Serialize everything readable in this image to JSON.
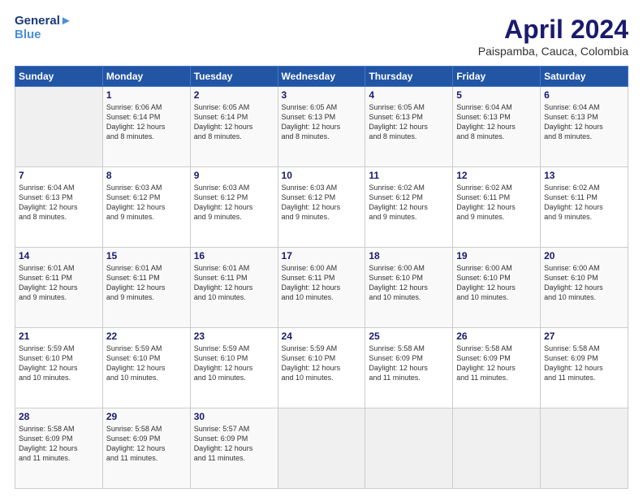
{
  "header": {
    "logo_line1": "General",
    "logo_line2": "Blue",
    "month": "April 2024",
    "location": "Paispamba, Cauca, Colombia"
  },
  "weekdays": [
    "Sunday",
    "Monday",
    "Tuesday",
    "Wednesday",
    "Thursday",
    "Friday",
    "Saturday"
  ],
  "weeks": [
    [
      {
        "day": "",
        "info": ""
      },
      {
        "day": "1",
        "info": "Sunrise: 6:06 AM\nSunset: 6:14 PM\nDaylight: 12 hours\nand 8 minutes."
      },
      {
        "day": "2",
        "info": "Sunrise: 6:05 AM\nSunset: 6:14 PM\nDaylight: 12 hours\nand 8 minutes."
      },
      {
        "day": "3",
        "info": "Sunrise: 6:05 AM\nSunset: 6:13 PM\nDaylight: 12 hours\nand 8 minutes."
      },
      {
        "day": "4",
        "info": "Sunrise: 6:05 AM\nSunset: 6:13 PM\nDaylight: 12 hours\nand 8 minutes."
      },
      {
        "day": "5",
        "info": "Sunrise: 6:04 AM\nSunset: 6:13 PM\nDaylight: 12 hours\nand 8 minutes."
      },
      {
        "day": "6",
        "info": "Sunrise: 6:04 AM\nSunset: 6:13 PM\nDaylight: 12 hours\nand 8 minutes."
      }
    ],
    [
      {
        "day": "7",
        "info": "Sunrise: 6:04 AM\nSunset: 6:13 PM\nDaylight: 12 hours\nand 8 minutes."
      },
      {
        "day": "8",
        "info": "Sunrise: 6:03 AM\nSunset: 6:12 PM\nDaylight: 12 hours\nand 9 minutes."
      },
      {
        "day": "9",
        "info": "Sunrise: 6:03 AM\nSunset: 6:12 PM\nDaylight: 12 hours\nand 9 minutes."
      },
      {
        "day": "10",
        "info": "Sunrise: 6:03 AM\nSunset: 6:12 PM\nDaylight: 12 hours\nand 9 minutes."
      },
      {
        "day": "11",
        "info": "Sunrise: 6:02 AM\nSunset: 6:12 PM\nDaylight: 12 hours\nand 9 minutes."
      },
      {
        "day": "12",
        "info": "Sunrise: 6:02 AM\nSunset: 6:11 PM\nDaylight: 12 hours\nand 9 minutes."
      },
      {
        "day": "13",
        "info": "Sunrise: 6:02 AM\nSunset: 6:11 PM\nDaylight: 12 hours\nand 9 minutes."
      }
    ],
    [
      {
        "day": "14",
        "info": "Sunrise: 6:01 AM\nSunset: 6:11 PM\nDaylight: 12 hours\nand 9 minutes."
      },
      {
        "day": "15",
        "info": "Sunrise: 6:01 AM\nSunset: 6:11 PM\nDaylight: 12 hours\nand 9 minutes."
      },
      {
        "day": "16",
        "info": "Sunrise: 6:01 AM\nSunset: 6:11 PM\nDaylight: 12 hours\nand 10 minutes."
      },
      {
        "day": "17",
        "info": "Sunrise: 6:00 AM\nSunset: 6:11 PM\nDaylight: 12 hours\nand 10 minutes."
      },
      {
        "day": "18",
        "info": "Sunrise: 6:00 AM\nSunset: 6:10 PM\nDaylight: 12 hours\nand 10 minutes."
      },
      {
        "day": "19",
        "info": "Sunrise: 6:00 AM\nSunset: 6:10 PM\nDaylight: 12 hours\nand 10 minutes."
      },
      {
        "day": "20",
        "info": "Sunrise: 6:00 AM\nSunset: 6:10 PM\nDaylight: 12 hours\nand 10 minutes."
      }
    ],
    [
      {
        "day": "21",
        "info": "Sunrise: 5:59 AM\nSunset: 6:10 PM\nDaylight: 12 hours\nand 10 minutes."
      },
      {
        "day": "22",
        "info": "Sunrise: 5:59 AM\nSunset: 6:10 PM\nDaylight: 12 hours\nand 10 minutes."
      },
      {
        "day": "23",
        "info": "Sunrise: 5:59 AM\nSunset: 6:10 PM\nDaylight: 12 hours\nand 10 minutes."
      },
      {
        "day": "24",
        "info": "Sunrise: 5:59 AM\nSunset: 6:10 PM\nDaylight: 12 hours\nand 10 minutes."
      },
      {
        "day": "25",
        "info": "Sunrise: 5:58 AM\nSunset: 6:09 PM\nDaylight: 12 hours\nand 11 minutes."
      },
      {
        "day": "26",
        "info": "Sunrise: 5:58 AM\nSunset: 6:09 PM\nDaylight: 12 hours\nand 11 minutes."
      },
      {
        "day": "27",
        "info": "Sunrise: 5:58 AM\nSunset: 6:09 PM\nDaylight: 12 hours\nand 11 minutes."
      }
    ],
    [
      {
        "day": "28",
        "info": "Sunrise: 5:58 AM\nSunset: 6:09 PM\nDaylight: 12 hours\nand 11 minutes."
      },
      {
        "day": "29",
        "info": "Sunrise: 5:58 AM\nSunset: 6:09 PM\nDaylight: 12 hours\nand 11 minutes."
      },
      {
        "day": "30",
        "info": "Sunrise: 5:57 AM\nSunset: 6:09 PM\nDaylight: 12 hours\nand 11 minutes."
      },
      {
        "day": "",
        "info": ""
      },
      {
        "day": "",
        "info": ""
      },
      {
        "day": "",
        "info": ""
      },
      {
        "day": "",
        "info": ""
      }
    ]
  ]
}
